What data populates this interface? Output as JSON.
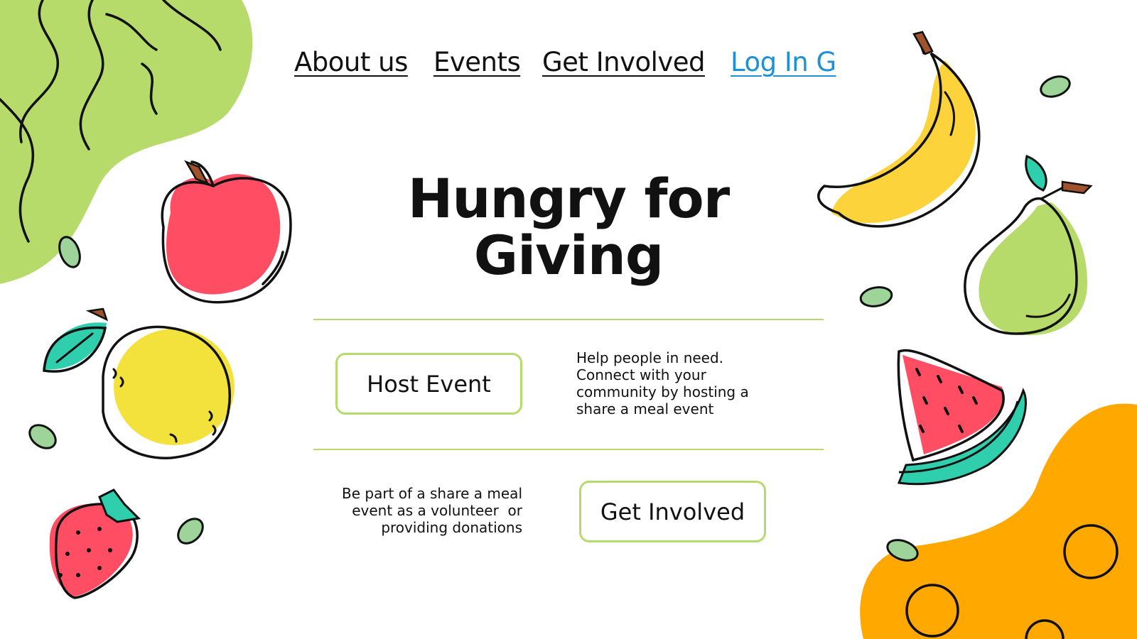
{
  "nav": {
    "items": [
      {
        "label": "About us"
      },
      {
        "label": "Events"
      },
      {
        "label": "Get Involved"
      },
      {
        "label": "Log In G"
      }
    ]
  },
  "hero": {
    "title_line1": "Hungry for",
    "title_line2": "Giving"
  },
  "host": {
    "button_label": "Host Event",
    "description": [
      "Help people in need.",
      "Connect with your",
      "community by hosting a",
      "share a meal event"
    ]
  },
  "involve": {
    "button_label": "Get Involved",
    "description": [
      "Be part of a share a meal",
      "event as a volunteer  or",
      "providing donations"
    ]
  },
  "colors": {
    "accent_green": "#b6db6b",
    "link_blue": "#1e90d6",
    "apple_red": "#ff4d64",
    "lemon_yellow": "#f3e23c",
    "banana_yellow": "#fcd33a",
    "leaf_teal": "#2fcfae",
    "orange_blob": "#ffa800"
  }
}
